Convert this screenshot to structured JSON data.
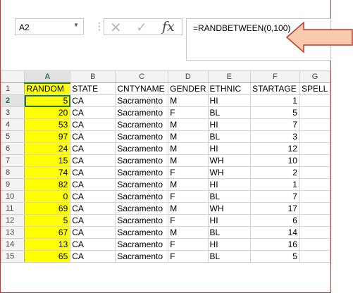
{
  "name_box": {
    "value": "A2"
  },
  "formula_bar": {
    "cancel_icon": "x-icon",
    "enter_icon": "check-icon",
    "fx_label": "fx",
    "formula": "=RANDBETWEEN(0,100)"
  },
  "colors": {
    "highlight": "#ffff00",
    "selection": "#217346",
    "callout_fill": "#f8cbad",
    "callout_stroke": "#c0392b"
  },
  "columns": [
    "A",
    "B",
    "C",
    "D",
    "E",
    "F",
    "G"
  ],
  "rows": [
    {
      "num": "1",
      "cells": [
        "RANDOM",
        "STATE",
        "CNTYNAME",
        "GENDER",
        "ETHNIC",
        "STARTAGE",
        "SPELL"
      ]
    },
    {
      "num": "2",
      "cells": [
        "5",
        "CA",
        "Sacramento",
        "M",
        "HI",
        "1",
        ""
      ]
    },
    {
      "num": "3",
      "cells": [
        "20",
        "CA",
        "Sacramento",
        "F",
        "BL",
        "5",
        ""
      ]
    },
    {
      "num": "4",
      "cells": [
        "53",
        "CA",
        "Sacramento",
        "M",
        "HI",
        "7",
        ""
      ]
    },
    {
      "num": "5",
      "cells": [
        "97",
        "CA",
        "Sacramento",
        "M",
        "BL",
        "3",
        ""
      ]
    },
    {
      "num": "6",
      "cells": [
        "24",
        "CA",
        "Sacramento",
        "M",
        "HI",
        "12",
        ""
      ]
    },
    {
      "num": "7",
      "cells": [
        "15",
        "CA",
        "Sacramento",
        "M",
        "WH",
        "10",
        ""
      ]
    },
    {
      "num": "8",
      "cells": [
        "74",
        "CA",
        "Sacramento",
        "F",
        "WH",
        "2",
        ""
      ]
    },
    {
      "num": "9",
      "cells": [
        "82",
        "CA",
        "Sacramento",
        "M",
        "HI",
        "1",
        ""
      ]
    },
    {
      "num": "10",
      "cells": [
        "0",
        "CA",
        "Sacramento",
        "F",
        "BL",
        "7",
        ""
      ]
    },
    {
      "num": "11",
      "cells": [
        "69",
        "CA",
        "Sacramento",
        "M",
        "WH",
        "17",
        ""
      ]
    },
    {
      "num": "12",
      "cells": [
        "5",
        "CA",
        "Sacramento",
        "F",
        "HI",
        "6",
        ""
      ]
    },
    {
      "num": "13",
      "cells": [
        "67",
        "CA",
        "Sacramento",
        "M",
        "BL",
        "14",
        ""
      ]
    },
    {
      "num": "14",
      "cells": [
        "13",
        "CA",
        "Sacramento",
        "F",
        "HI",
        "16",
        ""
      ]
    },
    {
      "num": "15",
      "cells": [
        "65",
        "CA",
        "Sacramento",
        "F",
        "BL",
        "5",
        ""
      ]
    }
  ],
  "active_cell": "A2"
}
